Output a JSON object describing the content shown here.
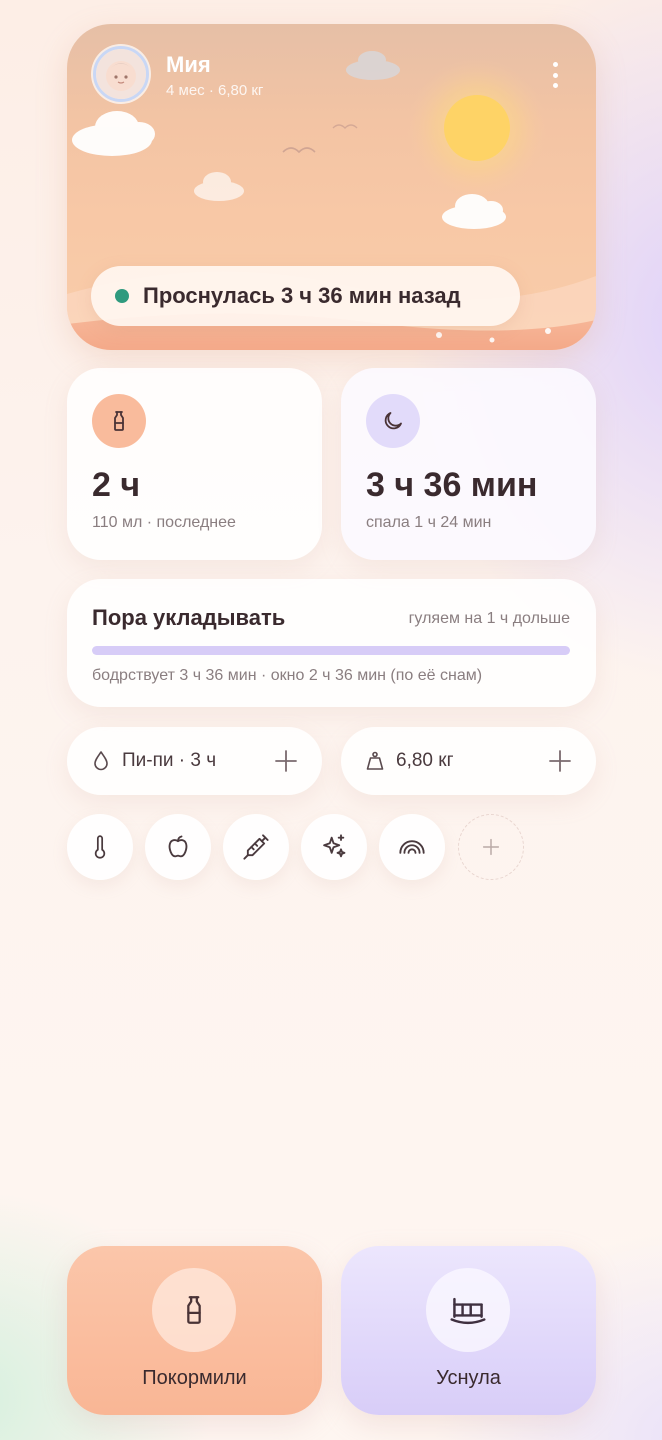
{
  "profile": {
    "name": "Мия",
    "meta": "4 мес · 6,80 кг"
  },
  "status": {
    "text": "Проснулась 3 ч 36 мин назад",
    "dot_color": "#2f9a7e"
  },
  "feed_card": {
    "icon": "bottle-icon",
    "value": "2 ч",
    "sub": "110 мл · последнее"
  },
  "sleep_stat_card": {
    "icon": "moon-icon",
    "value": "3 ч 36 мин",
    "sub": "спала 1 ч 24 мин"
  },
  "sleep_window": {
    "title": "Пора укладывать",
    "extra": "гуляем на 1 ч дольше",
    "sub": "бодрствует 3 ч 36 мин · окно 2 ч 36 мин (по её снам)",
    "progress": 1.0
  },
  "mini_cards": {
    "pee": {
      "icon": "drop-icon",
      "label": "Пи-пи · 3 ч"
    },
    "weight": {
      "icon": "weight-icon",
      "label": "6,80 кг"
    }
  },
  "quick_actions": [
    {
      "icon": "thermometer-icon"
    },
    {
      "icon": "apple-icon"
    },
    {
      "icon": "syringe-icon"
    },
    {
      "icon": "sparkle-icon"
    },
    {
      "icon": "rainbow-icon"
    },
    {
      "icon": "plus-icon"
    }
  ],
  "actions": {
    "feed": {
      "icon": "bottle-icon",
      "label": "Покормили"
    },
    "sleep": {
      "icon": "crib-icon",
      "label": "Уснула"
    }
  },
  "colors": {
    "accent_peach": "#f9b695",
    "accent_lavender": "#d8cdf8",
    "text_dark": "#3a2a2e",
    "text_muted": "#8a7e80"
  }
}
